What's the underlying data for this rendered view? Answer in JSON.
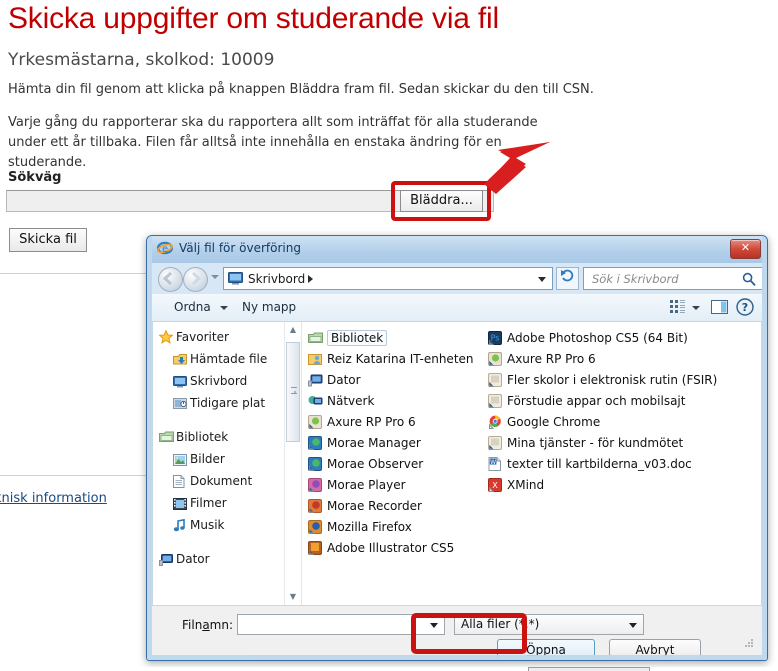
{
  "page": {
    "title": "Skicka uppgifter om studerande via fil",
    "subtitle": "Yrkesmästarna, skolkod: 10009",
    "paragraph1": "Hämta din fil genom att klicka på knappen Bläddra fram fil. Sedan skickar du den till CSN.",
    "paragraph2": "Varje gång du rapporterar ska du rapportera allt som inträffat för alla studerande under ett år tillbaka. Filen får alltså inte innehålla en enstaka ändring för en studerande.",
    "sokvag_label": "Sökväg",
    "path_value": "",
    "browse_button": "Bläddra...",
    "send_button": "Skicka fil",
    "tech_link": "knisk information",
    "accent_color": "#c00000",
    "callout_color": "#cc1111"
  },
  "dialog": {
    "title": "Välj fil för överföring",
    "close_label": "✕",
    "address": {
      "current": "Skrivbord",
      "icon": "desktop-icon"
    },
    "search": {
      "placeholder": "Sök i Skrivbord"
    },
    "toolbar": {
      "organize": "Ordna",
      "new_folder": "Ny mapp"
    },
    "navpane": [
      {
        "label": "Favoriter",
        "icon": "star-icon",
        "level": "head"
      },
      {
        "label": "Hämtade file",
        "icon": "downloads-icon",
        "level": "child"
      },
      {
        "label": "Skrivbord",
        "icon": "desktop-icon",
        "level": "child"
      },
      {
        "label": "Tidigare plat",
        "icon": "recent-icon",
        "level": "child"
      },
      {
        "label": "Bibliotek",
        "icon": "library-icon",
        "level": "head"
      },
      {
        "label": "Bilder",
        "icon": "pictures-icon",
        "level": "child"
      },
      {
        "label": "Dokument",
        "icon": "documents-icon",
        "level": "child"
      },
      {
        "label": "Filmer",
        "icon": "videos-icon",
        "level": "child"
      },
      {
        "label": "Musik",
        "icon": "music-icon",
        "level": "child"
      },
      {
        "label": "Dator",
        "icon": "computer-icon",
        "level": "head"
      }
    ],
    "files_col1": [
      {
        "label": "Bibliotek",
        "icon": "folder-icon",
        "selected": true
      },
      {
        "label": "Reiz Katarina IT-enheten",
        "icon": "user-folder-icon",
        "selected": false
      },
      {
        "label": "Dator",
        "icon": "computer-icon",
        "selected": false
      },
      {
        "label": "Nätverk",
        "icon": "network-icon",
        "selected": false
      },
      {
        "label": "Axure RP Pro 6",
        "icon": "shortcut-icon",
        "selected": false
      },
      {
        "label": "Morae Manager",
        "icon": "shortcut-icon",
        "selected": false
      },
      {
        "label": "Morae Observer",
        "icon": "shortcut-icon",
        "selected": false
      },
      {
        "label": "Morae Player",
        "icon": "shortcut-icon",
        "selected": false
      },
      {
        "label": "Morae Recorder",
        "icon": "shortcut-icon",
        "selected": false
      },
      {
        "label": "Mozilla Firefox",
        "icon": "shortcut-icon",
        "selected": false
      },
      {
        "label": "Adobe Illustrator CS5",
        "icon": "shortcut-icon",
        "selected": false
      }
    ],
    "files_col2": [
      {
        "label": "Adobe Photoshop CS5 (64 Bit)",
        "icon": "shortcut-icon"
      },
      {
        "label": "Axure RP Pro 6",
        "icon": "shortcut-icon"
      },
      {
        "label": "Fler skolor i elektronisk rutin (FSIR)",
        "icon": "shortcut-icon"
      },
      {
        "label": "Förstudie appar och mobilsajt",
        "icon": "shortcut-icon"
      },
      {
        "label": "Google Chrome",
        "icon": "chrome-icon"
      },
      {
        "label": "Mina tjänster - för kundmötet",
        "icon": "shortcut-icon"
      },
      {
        "label": "texter till kartbilderna_v03.doc",
        "icon": "word-doc-icon"
      },
      {
        "label": "XMind",
        "icon": "xmind-icon"
      }
    ],
    "footer": {
      "filename_label": "Filnamn:",
      "filename_value": "",
      "filter_value": "Alla filer (*.*)",
      "open_button": "Öppna",
      "cancel_button": "Avbryt"
    }
  }
}
